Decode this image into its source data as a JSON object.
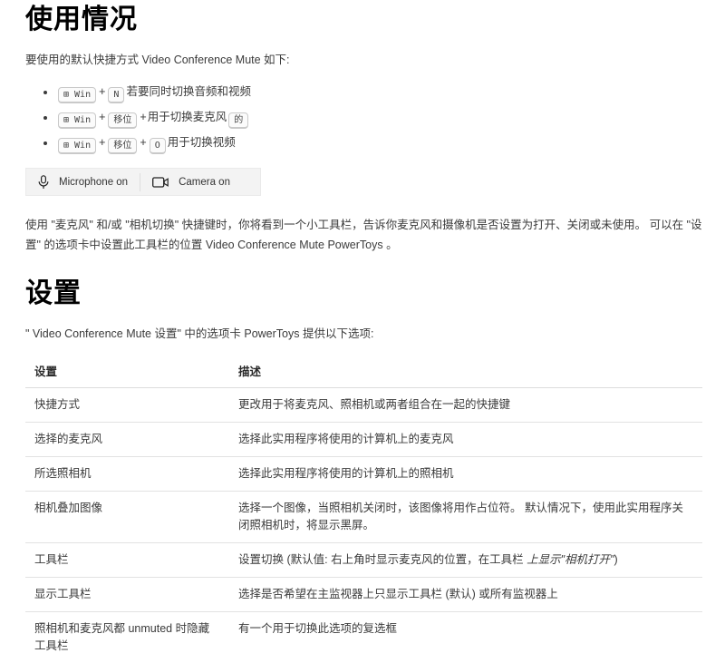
{
  "usage": {
    "heading": "使用情况",
    "intro": "要使用的默认快捷方式 Video Conference Mute 如下:",
    "shortcut1": {
      "win": "⊞ Win",
      "plus1": "+",
      "key": "N",
      "text": "若要同时切换音频和视频"
    },
    "shortcut2": {
      "win": "⊞ Win",
      "plus1": "+",
      "shift": "移位",
      "plus2": "+",
      "text": "用于切换麦克风",
      "key": "的"
    },
    "shortcut3": {
      "win": "⊞ Win",
      "plus1": "+",
      "shift": "移位",
      "plus2": "+",
      "key": "O",
      "text": "用于切换视频"
    },
    "toolbar_preview": {
      "mic_label": "Microphone on",
      "camera_label": "Camera on",
      "background_color": "#f3f3f3"
    },
    "description": "使用 \"麦克风\" 和/或 \"相机切换\" 快捷键时，你将看到一个小工具栏，告诉你麦克风和摄像机是否设置为打开、关闭或未使用。 可以在 \"设置\" 的选项卡中设置此工具栏的位置 Video Conference Mute PowerToys 。"
  },
  "settings": {
    "heading": "设置",
    "intro": "\" Video Conference Mute 设置\" 中的选项卡 PowerToys 提供以下选项:",
    "table": {
      "col_setting": "设置",
      "col_description": "描述",
      "rows": [
        {
          "setting": "快捷方式",
          "desc": "更改用于将麦克风、照相机或两者组合在一起的快捷键"
        },
        {
          "setting": "选择的麦克风",
          "desc": "选择此实用程序将使用的计算机上的麦克风"
        },
        {
          "setting": "所选照相机",
          "desc": "选择此实用程序将使用的计算机上的照相机"
        },
        {
          "setting": "相机叠加图像",
          "desc": "选择一个图像，当照相机关闭时，该图像将用作占位符。 默认情况下，使用此实用程序关闭照相机时，将显示黑屏。"
        },
        {
          "setting": "工具栏",
          "desc": "设置切换 (默认值: 右上角时显示麦克风的位置，在工具栏 ",
          "desc_italic": "上显示\"相机打开\"",
          "desc_end": ")"
        },
        {
          "setting": "显示工具栏",
          "desc": "选择是否希望在主监视器上只显示工具栏 (默认) 或所有监视器上"
        },
        {
          "setting": "照相机和麦克风都 unmuted 时隐藏工具栏",
          "desc": "有一个用于切换此选项的复选框"
        }
      ]
    }
  }
}
